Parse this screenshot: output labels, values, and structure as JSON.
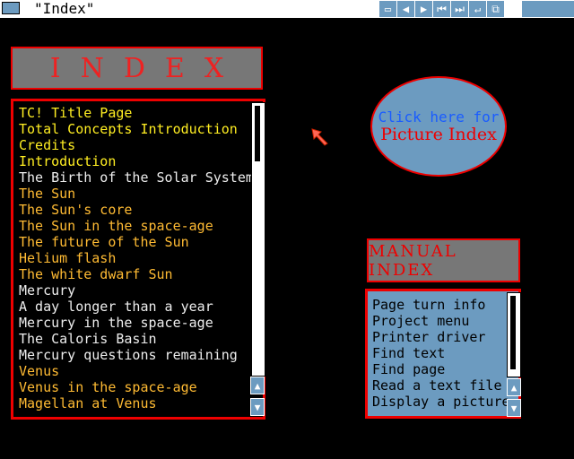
{
  "window": {
    "title": "\"Index\""
  },
  "index_header": {
    "label": "INDEX"
  },
  "main_list": [
    {
      "label": "TC! Title Page",
      "color": "yellow"
    },
    {
      "label": "Total Concepts Introduction",
      "color": "yellow"
    },
    {
      "label": "Credits",
      "color": "yellow"
    },
    {
      "label": "Introduction",
      "color": "yellow"
    },
    {
      "label": "The Birth of the Solar System",
      "color": "white"
    },
    {
      "label": "The Sun",
      "color": "orange"
    },
    {
      "label": "The Sun's core",
      "color": "orange"
    },
    {
      "label": "The Sun in the space-age",
      "color": "orange"
    },
    {
      "label": "The future of the Sun",
      "color": "orange"
    },
    {
      "label": "Helium flash",
      "color": "orange"
    },
    {
      "label": "The white dwarf Sun",
      "color": "orange"
    },
    {
      "label": "Mercury",
      "color": "white"
    },
    {
      "label": "A day longer than a year",
      "color": "white"
    },
    {
      "label": "Mercury in the space-age",
      "color": "white"
    },
    {
      "label": "The Caloris Basin",
      "color": "white"
    },
    {
      "label": "Mercury questions remaining",
      "color": "white"
    },
    {
      "label": "Venus",
      "color": "orange"
    },
    {
      "label": "Venus in the space-age",
      "color": "orange"
    },
    {
      "label": "Magellan at Venus",
      "color": "orange"
    }
  ],
  "picture_button": {
    "line1": "Click here for",
    "line2": "Picture Index"
  },
  "manual_header": {
    "label": "MANUAL INDEX"
  },
  "manual_list": [
    "Page turn info",
    "Project menu",
    "Printer driver",
    "Find text",
    "Find page",
    "Read a text file",
    "Display a picture"
  ],
  "colors": {
    "accent": "#ee0000",
    "panel_blue": "#6c9bc0",
    "yellow": "#ffee22",
    "orange": "#ffbb33"
  }
}
